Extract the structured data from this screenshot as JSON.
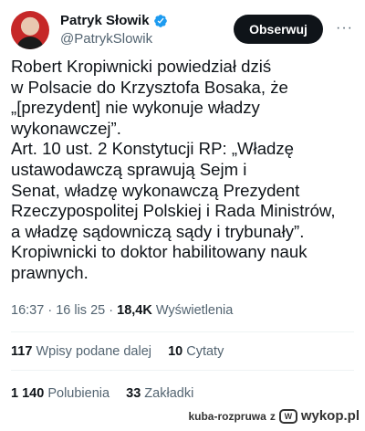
{
  "author": {
    "name": "Patryk Słowik",
    "handle": "@PatrykSlowik",
    "follow_label": "Obserwuj",
    "more_label": "···"
  },
  "tweet": {
    "lines": [
      "Robert Kropiwnicki powiedział dziś",
      "w Polsacie do Krzysztofa Bosaka, że",
      "„[prezydent] nie wykonuje władzy",
      "wykonawczej”.",
      "Art. 10 ust. 2 Konstytucji RP: „Władzę",
      "ustawodawczą sprawują Sejm i",
      "Senat, władzę wykonawczą Prezydent",
      "Rzeczypospolitej Polskiej i Rada Ministrów,",
      "a władzę sądowniczą sądy i trybunały”.",
      "Kropiwnicki to doktor habilitowany nauk",
      "prawnych."
    ]
  },
  "meta": {
    "time": "16:37",
    "date": "16 lis 25",
    "views_count": "18,4K",
    "views_label": "Wyświetlenia",
    "separator": "·"
  },
  "stats": {
    "reposts_count": "117",
    "reposts_label": "Wpisy podane dalej",
    "quotes_count": "10",
    "quotes_label": "Cytaty",
    "likes_count": "1 140",
    "likes_label": "Polubienia",
    "bookmarks_count": "33",
    "bookmarks_label": "Zakładki"
  },
  "footer": {
    "user": "kuba-rozpruwa",
    "connector": "z",
    "logo_text": "W",
    "brand": "wykop.pl"
  },
  "colors": {
    "text": "#0f1419",
    "muted": "#536471",
    "verified": "#1d9bf0",
    "button_bg": "#0f1419"
  }
}
